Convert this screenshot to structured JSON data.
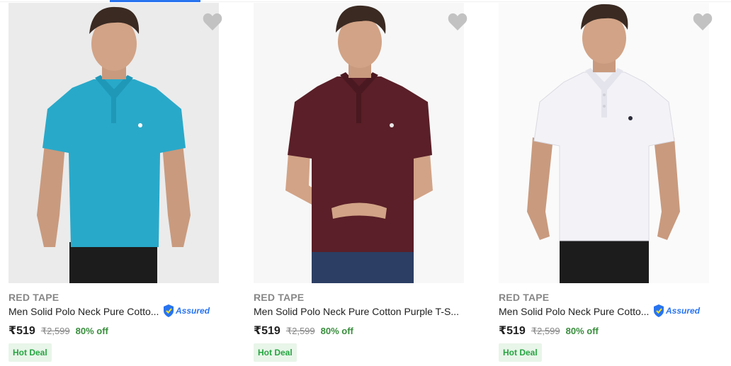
{
  "products": [
    {
      "brand": "RED TAPE",
      "title": "Men Solid Polo Neck Pure Cotto...",
      "assured": "Assured",
      "price": "₹519",
      "mrp": "₹2,599",
      "discount": "80% off",
      "badge": "Hot Deal",
      "shirt_color": "#29a9c9",
      "bg_color": "#ebebeb",
      "show_assured": true
    },
    {
      "brand": "RED TAPE",
      "title": "Men Solid Polo Neck Pure Cotton Purple T-S...",
      "price": "₹519",
      "mrp": "₹2,599",
      "discount": "80% off",
      "badge": "Hot Deal",
      "shirt_color": "#5a1f28",
      "bg_color": "#f7f7f7",
      "show_assured": false
    },
    {
      "brand": "RED TAPE",
      "title": "Men Solid Polo Neck Pure Cotto...",
      "assured": "Assured",
      "price": "₹519",
      "mrp": "₹2,599",
      "discount": "80% off",
      "badge": "Hot Deal",
      "shirt_color": "#f3f3f7",
      "bg_color": "#fafafa",
      "show_assured": true
    }
  ],
  "icons": {
    "wishlist": "heart-icon",
    "assured": "assured-shield-icon"
  },
  "colors": {
    "accent": "#2874f0",
    "discount_green": "#388e3c",
    "badge_bg": "#e8f5e9",
    "muted": "#878787"
  }
}
